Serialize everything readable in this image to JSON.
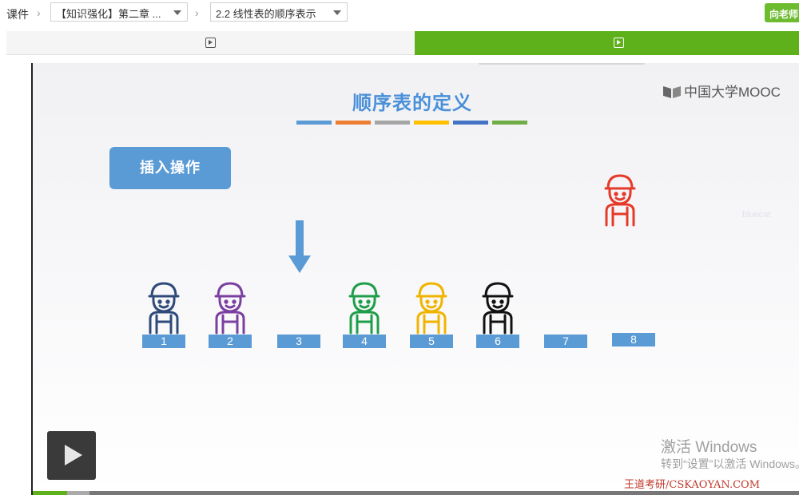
{
  "breadcrumb": {
    "root": "课件",
    "chapter": "【知识强化】第二章 ...",
    "lesson": "2.2 线性表的顺序表示"
  },
  "ask_button": "向老师",
  "video": {
    "progress_fraction": 0.045,
    "slide": {
      "title": "顺序表的定义",
      "color_bars": [
        "#5b9bd5",
        "#ed7d31",
        "#a5a5a5",
        "#ffc000",
        "#4472c4",
        "#70ad47"
      ],
      "logo_text": "中国大学MOOC",
      "insert_label": "插入操作",
      "slots": [
        "1",
        "2",
        "3",
        "4",
        "5",
        "6",
        "7",
        "8"
      ],
      "people": [
        {
          "slot": 1,
          "color": "#2f4a7a"
        },
        {
          "slot": 2,
          "color": "#7b3fa0"
        },
        {
          "slot": 4,
          "color": "#1e9e4a"
        },
        {
          "slot": 5,
          "color": "#f0b400"
        },
        {
          "slot": 6,
          "color": "#111111"
        }
      ],
      "new_person_color": "#e53a2a",
      "faint_text": "bluecat"
    },
    "activation_title": "激活 Windows",
    "activation_sub": "转到“设置”以激活 Windows。",
    "watermark": "王道考研/CSKAOYAN.COM"
  }
}
